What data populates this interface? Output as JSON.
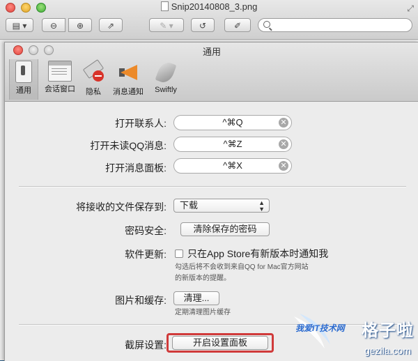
{
  "outer_window": {
    "title": "Snip20140808_3.png",
    "icons": [
      "sidebar-icon",
      "zoom-out-icon",
      "zoom-in-icon",
      "share-icon",
      "markup-icon",
      "rotate-icon",
      "edit-icon",
      "search-icon",
      "fullscreen-icon"
    ]
  },
  "prefs": {
    "title": "通用",
    "tabs": [
      {
        "label": "通用",
        "icon": "switch-icon",
        "selected": true
      },
      {
        "label": "会话窗口",
        "icon": "chat-window-icon"
      },
      {
        "label": "隐私",
        "icon": "privacy-icon"
      },
      {
        "label": "消息通知",
        "icon": "megaphone-icon"
      },
      {
        "label": "Swiftly",
        "icon": "swift-bird-icon"
      }
    ],
    "shortcuts": [
      {
        "label": "打开联系人:",
        "value": "^⌘Q"
      },
      {
        "label": "打开未读QQ消息:",
        "value": "^⌘Z"
      },
      {
        "label": "打开消息面板:",
        "value": "^⌘X"
      }
    ],
    "save_to": {
      "label": "将接收的文件保存到:",
      "value": "下载"
    },
    "password": {
      "label": "密码安全:",
      "button": "清除保存的密码"
    },
    "update": {
      "label": "软件更新:",
      "checkbox_label": "只在App Store有新版本时通知我",
      "checked": false,
      "hint_line1": "勾选后将不会收到来自QQ for Mac官方网站",
      "hint_line2": "的新版本的提醒。"
    },
    "cache": {
      "label": "图片和缓存:",
      "button": "清理...",
      "hint": "定期清理图片缓存"
    },
    "screenshot": {
      "label": "截屏设置:",
      "button": "开启设置面板"
    }
  },
  "watermark": {
    "site_cn": "格子啦",
    "url": "gezila.com",
    "ribbon": "我爱IT技术网"
  },
  "colors": {
    "highlight": "#d03a3a",
    "desktop": "#2a5b82"
  }
}
